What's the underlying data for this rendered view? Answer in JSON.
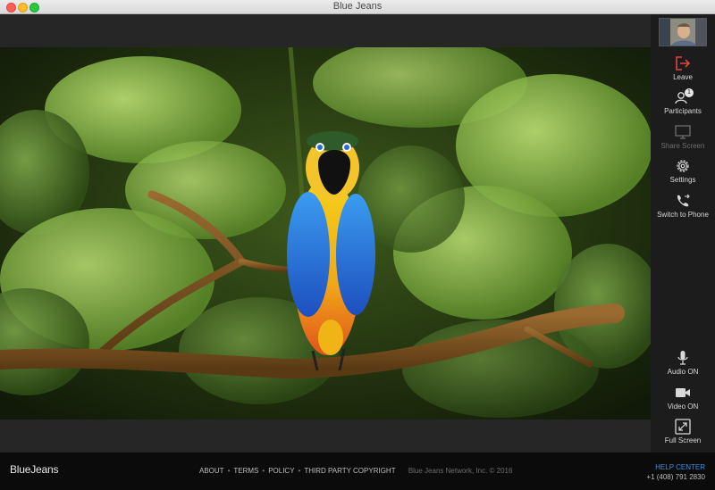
{
  "window": {
    "title": "Blue Jeans"
  },
  "controls": {
    "leave": "Leave",
    "participants": "Participants",
    "participants_count": "1",
    "share_screen": "Share Screen",
    "settings": "Settings",
    "switch_to_phone": "Switch to Phone",
    "audio": "Audio ON",
    "video": "Video ON",
    "full_screen": "Full Screen"
  },
  "footer": {
    "logo": "BlueJeans",
    "links": [
      "ABOUT",
      "TERMS",
      "POLICY",
      "THIRD PARTY COPYRIGHT"
    ],
    "copyright": "Blue Jeans Network, Inc. © 2016",
    "help_center": "HELP CENTER",
    "phone": "+1 (408) 791 2830"
  },
  "colors": {
    "leave_red": "#e2453c",
    "help_blue": "#3a8fe0"
  }
}
